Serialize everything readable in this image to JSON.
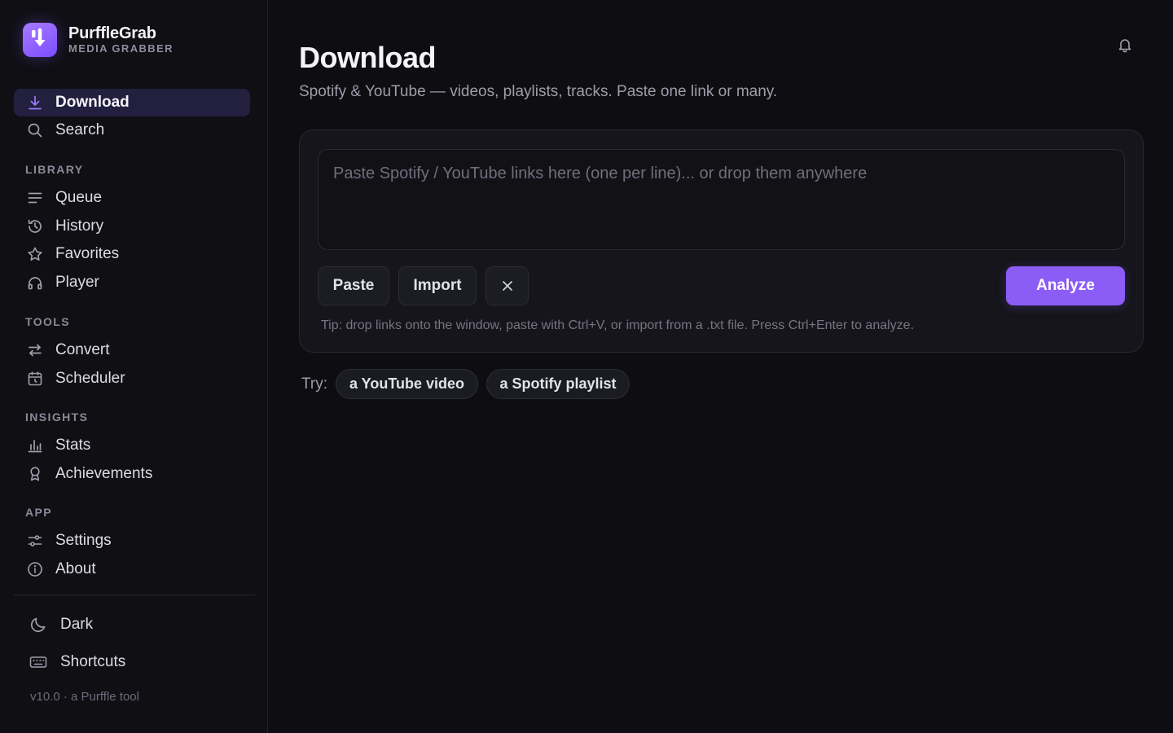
{
  "brand": {
    "name": "PurffleGrab",
    "subtitle": "MEDIA GRABBER",
    "accent": "#8b5cf6"
  },
  "sidebar": {
    "primary": [
      {
        "label": "Download",
        "icon": "download-icon",
        "active": true
      },
      {
        "label": "Search",
        "icon": "search-icon",
        "active": false
      }
    ],
    "sections": [
      {
        "title": "LIBRARY",
        "items": [
          {
            "label": "Queue",
            "icon": "queue-icon"
          },
          {
            "label": "History",
            "icon": "history-icon"
          },
          {
            "label": "Favorites",
            "icon": "star-icon"
          },
          {
            "label": "Player",
            "icon": "headphones-icon"
          }
        ]
      },
      {
        "title": "TOOLS",
        "items": [
          {
            "label": "Convert",
            "icon": "convert-icon"
          },
          {
            "label": "Scheduler",
            "icon": "calendar-icon"
          }
        ]
      },
      {
        "title": "INSIGHTS",
        "items": [
          {
            "label": "Stats",
            "icon": "bar-chart-icon"
          },
          {
            "label": "Achievements",
            "icon": "award-icon"
          }
        ]
      },
      {
        "title": "APP",
        "items": [
          {
            "label": "Settings",
            "icon": "sliders-icon"
          },
          {
            "label": "About",
            "icon": "info-icon"
          }
        ]
      }
    ],
    "footer": [
      {
        "label": "Dark",
        "icon": "moon-icon"
      },
      {
        "label": "Shortcuts",
        "icon": "keyboard-icon"
      }
    ],
    "version": "v10.0 · a Purffle tool"
  },
  "main": {
    "title": "Download",
    "subtitle": "Spotify & YouTube — videos, playlists, tracks. Paste one link or many.",
    "input": {
      "value": "",
      "placeholder": "Paste Spotify / YouTube links here (one per line)... or drop them anywhere"
    },
    "buttons": {
      "paste": "Paste",
      "import": "Import",
      "analyze": "Analyze"
    },
    "tip": "Tip: drop links onto the window, paste with Ctrl+V, or import from a .txt file. Press Ctrl+Enter to analyze.",
    "try_label": "Try:",
    "examples": [
      "a YouTube video",
      "a Spotify playlist"
    ]
  }
}
